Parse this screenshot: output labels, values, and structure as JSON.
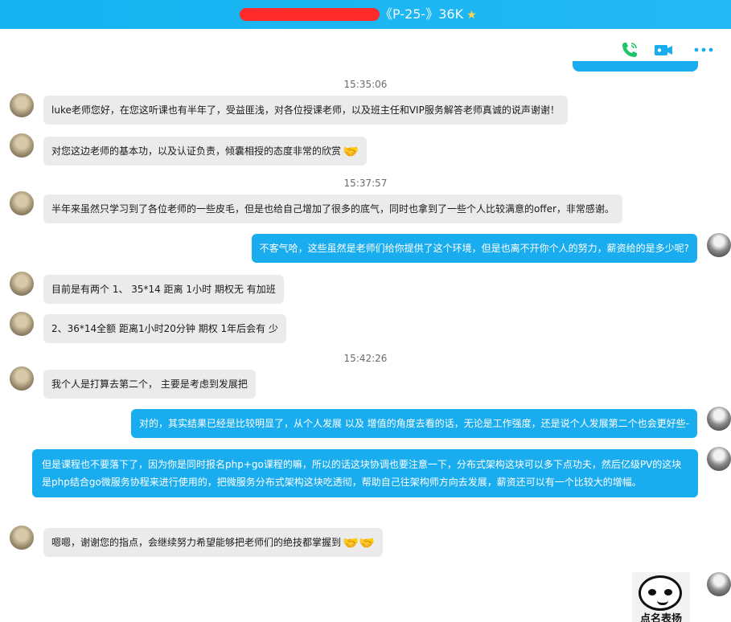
{
  "window": {
    "title": "《P-25-》36K",
    "star": "★"
  },
  "toolbar": {
    "phone_label": "",
    "video_label": "",
    "more_label": "•••"
  },
  "timestamps": [
    "15:35:06",
    "15:37:57",
    "15:42:26"
  ],
  "messages": [
    {
      "side": "left",
      "text": "luke老师您好，在您这听课也有半年了，受益匪浅，对各位授课老师，以及班主任和VIP服务解答老师真诚的说声谢谢！"
    },
    {
      "side": "left",
      "text": "对您这边老师的基本功，以及认证负责，倾囊相授的态度非常的欣赏",
      "emoji": "🤝"
    },
    {
      "side": "left",
      "text": "半年来虽然只学习到了各位老师的一些皮毛，但是也给自己增加了很多的底气，同时也拿到了一些个人比较满意的offer，非常感谢。"
    },
    {
      "side": "right",
      "text": "不客气哈，这些虽然是老师们给你提供了这个环境，但是也离不开你个人的努力，薪资给的是多少呢?"
    },
    {
      "side": "left",
      "text": "目前是有两个 1、  35*14   距离 1小时  期权无   有加班"
    },
    {
      "side": "left",
      "text": "2、36*14全额  距离1小时20分钟   期权 1年后会有   少"
    },
    {
      "side": "left",
      "text": "我个人是打算去第二个，  主要是考虑到发展把"
    },
    {
      "side": "right",
      "text": "对的，其实结果已经是比较明显了，从个人发展 以及 增值的角度去看的话，无论是工作强度，还是说个人发展第二个也会更好些-"
    },
    {
      "side": "right",
      "text": "但是课程也不要落下了，因为你是同时报名php+go课程的嘛，所以的话这块协调也要注意一下，分布式架构这块可以多下点功夫，然后亿级PV的这块是php结合go微服务协程来进行使用的，把微服务分布式架构这块吃透彻，帮助自己往架构师方向去发展，薪资还可以有一个比较大的增幅。"
    },
    {
      "side": "left",
      "text": "嗯嗯，谢谢您的指点，会继续努力希望能够把老师们的绝技都掌握到",
      "emoji": "🤝🤝"
    }
  ],
  "sticker": {
    "caption": "点名表扬"
  },
  "colors": {
    "accent": "#19acef",
    "titlebar": "#15b4f1",
    "left_bubble": "#ebebeb",
    "redaction": "#ff2a2a"
  }
}
